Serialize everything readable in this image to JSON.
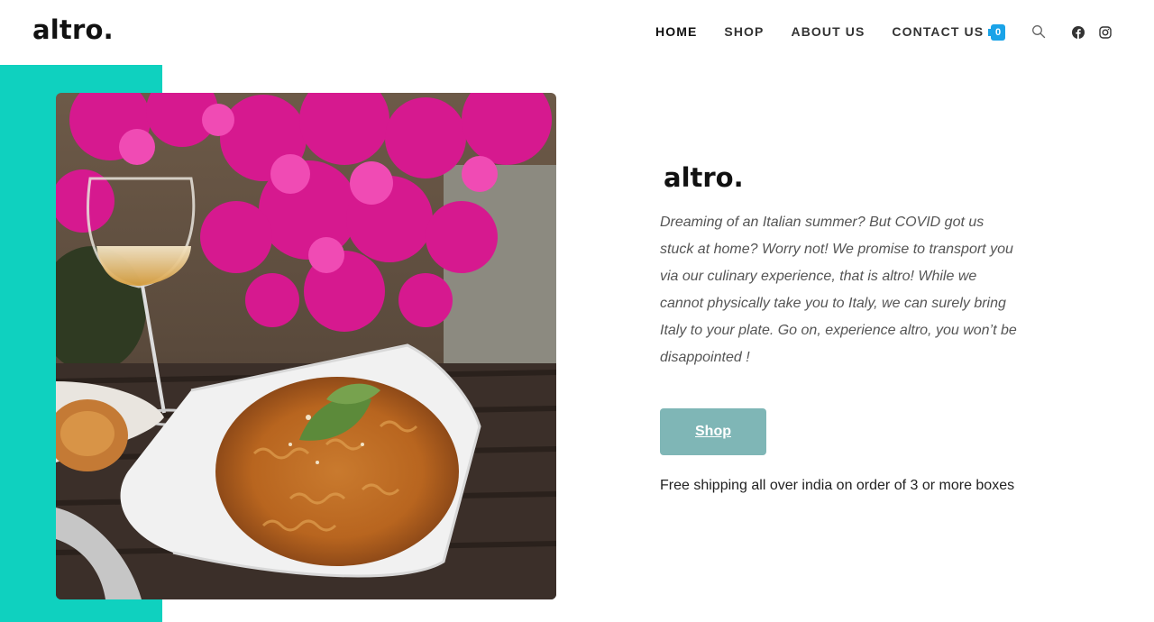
{
  "header": {
    "logo": "altro.",
    "nav": [
      {
        "label": "HOME",
        "active": true
      },
      {
        "label": "SHOP",
        "active": false
      },
      {
        "label": "ABOUT US",
        "active": false
      },
      {
        "label": "CONTACT US",
        "active": false
      }
    ],
    "cart_count": "0",
    "icons": [
      "cart-icon",
      "search-icon",
      "facebook-icon",
      "instagram-icon"
    ]
  },
  "hero": {
    "image_alt": "Pasta dish with basil, glass of wine and pink bougainvillea flowers",
    "brand": "altro.",
    "tagline": "Dreaming of an Italian summer? But COVID got us stuck at home? Worry not! We promise to transport you via our culinary experience, that is altro! While we cannot physically take you to Italy, we can surely bring Italy to your plate. Go on, experience altro, you won’t be disappointed !",
    "shop_button": "Shop",
    "shipping_note": "Free  shipping all over india on order of 3 or more boxes"
  },
  "colors": {
    "accent_teal": "#0fd1bf",
    "button": "#7fb6b6",
    "cart_badge": "#1aa3e8"
  }
}
